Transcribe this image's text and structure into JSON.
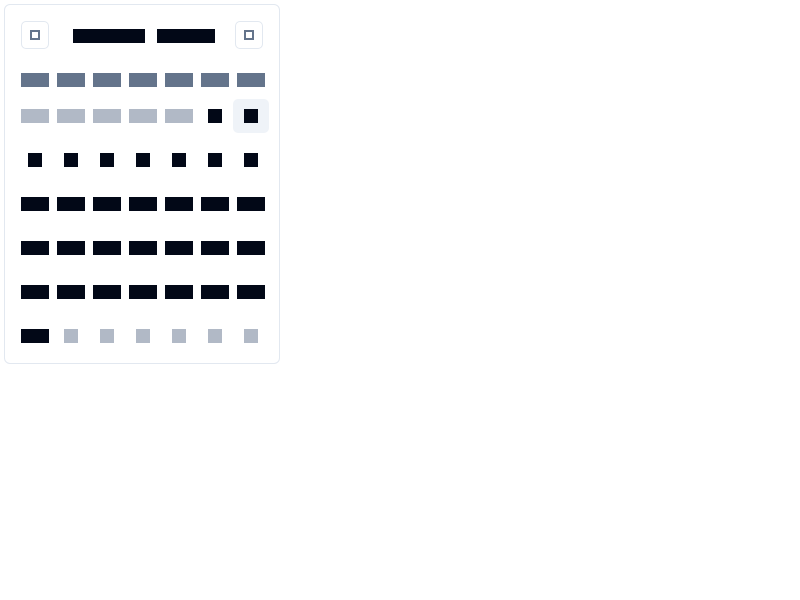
{
  "calendar": {
    "month_label": "",
    "year_label": "",
    "prev_icon": "chevron-left-icon",
    "next_icon": "chevron-right-icon",
    "weekdays": [
      "",
      "",
      "",
      "",
      "",
      "",
      ""
    ],
    "weeks": [
      [
        {
          "label": "",
          "width": "wide",
          "outside": true
        },
        {
          "label": "",
          "width": "wide",
          "outside": true
        },
        {
          "label": "",
          "width": "wide",
          "outside": true
        },
        {
          "label": "",
          "width": "wide",
          "outside": true
        },
        {
          "label": "",
          "width": "wide",
          "outside": true
        },
        {
          "label": "",
          "width": "narrow",
          "outside": false
        },
        {
          "label": "",
          "width": "narrow",
          "outside": false,
          "today": true
        }
      ],
      [
        {
          "label": "",
          "width": "narrow",
          "outside": false
        },
        {
          "label": "",
          "width": "narrow",
          "outside": false
        },
        {
          "label": "",
          "width": "narrow",
          "outside": false
        },
        {
          "label": "",
          "width": "narrow",
          "outside": false
        },
        {
          "label": "",
          "width": "narrow",
          "outside": false
        },
        {
          "label": "",
          "width": "narrow",
          "outside": false
        },
        {
          "label": "",
          "width": "narrow",
          "outside": false
        }
      ],
      [
        {
          "label": "",
          "width": "wide",
          "outside": false
        },
        {
          "label": "",
          "width": "wide",
          "outside": false
        },
        {
          "label": "",
          "width": "wide",
          "outside": false
        },
        {
          "label": "",
          "width": "wide",
          "outside": false
        },
        {
          "label": "",
          "width": "wide",
          "outside": false
        },
        {
          "label": "",
          "width": "wide",
          "outside": false
        },
        {
          "label": "",
          "width": "wide",
          "outside": false
        }
      ],
      [
        {
          "label": "",
          "width": "wide",
          "outside": false
        },
        {
          "label": "",
          "width": "wide",
          "outside": false
        },
        {
          "label": "",
          "width": "wide",
          "outside": false
        },
        {
          "label": "",
          "width": "wide",
          "outside": false
        },
        {
          "label": "",
          "width": "wide",
          "outside": false
        },
        {
          "label": "",
          "width": "wide",
          "outside": false
        },
        {
          "label": "",
          "width": "wide",
          "outside": false
        }
      ],
      [
        {
          "label": "",
          "width": "wide",
          "outside": false
        },
        {
          "label": "",
          "width": "wide",
          "outside": false
        },
        {
          "label": "",
          "width": "wide",
          "outside": false
        },
        {
          "label": "",
          "width": "wide",
          "outside": false
        },
        {
          "label": "",
          "width": "wide",
          "outside": false
        },
        {
          "label": "",
          "width": "wide",
          "outside": false
        },
        {
          "label": "",
          "width": "wide",
          "outside": false
        }
      ],
      [
        {
          "label": "",
          "width": "wide",
          "outside": false
        },
        {
          "label": "",
          "width": "narrow",
          "outside": true
        },
        {
          "label": "",
          "width": "narrow",
          "outside": true
        },
        {
          "label": "",
          "width": "narrow",
          "outside": true
        },
        {
          "label": "",
          "width": "narrow",
          "outside": true
        },
        {
          "label": "",
          "width": "narrow",
          "outside": true
        },
        {
          "label": "",
          "width": "narrow",
          "outside": true
        }
      ]
    ]
  },
  "colors": {
    "text": "#020817",
    "muted": "#64748b",
    "outside_day": "#b1b9c6",
    "border": "#e2e8f0",
    "today_background": "#eff3f8"
  }
}
